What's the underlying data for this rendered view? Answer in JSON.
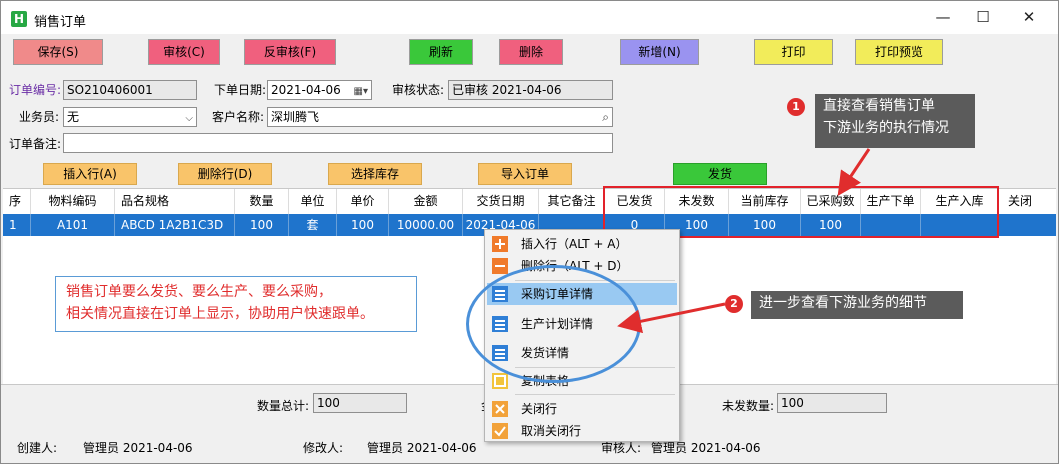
{
  "window": {
    "title": "销售订单",
    "icon_letter": "H",
    "minimize": "—",
    "maximize": "☐",
    "close": "✕"
  },
  "toolbar": {
    "save": "保存(S)",
    "review": "审核(C)",
    "unreview": "反审核(F)",
    "refresh": "刷新",
    "delete": "删除",
    "add": "新增(N)",
    "print": "打印",
    "print_preview": "打印预览"
  },
  "form": {
    "order_no_label": "订单编号:",
    "order_no": "SO210406001",
    "order_date_label": "下单日期:",
    "order_date": "2021-04-06",
    "audit_status_label": "审核状态:",
    "audit_status": "已审核 2021-04-06",
    "salesman_label": "业务员:",
    "salesman": "无",
    "customer_label": "客户名称:",
    "customer": "深圳腾飞",
    "remark_label": "订单备注:",
    "remark": ""
  },
  "subtoolbar": {
    "insert_row": "插入行(A)",
    "delete_row": "删除行(D)",
    "select_stock": "选择库存",
    "import_order": "导入订单",
    "ship": "发货"
  },
  "table": {
    "headers": [
      "序号",
      "物料编码",
      "品名规格",
      "数量",
      "单位",
      "单价",
      "金额",
      "交货日期",
      "其它备注",
      "已发货",
      "未发数",
      "当前库存",
      "已采购数",
      "生产下单",
      "生产入库",
      "关闭"
    ],
    "rows": [
      [
        "1",
        "A101",
        "ABCD 1A2B1C3D",
        "100",
        "套",
        "100",
        "10000.00",
        "2021-04-06",
        "",
        "0",
        "100",
        "100",
        "100",
        "",
        "",
        ""
      ]
    ]
  },
  "callouts": {
    "c1_num": "1",
    "c1_line1": "直接查看销售订单",
    "c1_line2": "下游业务的执行情况",
    "c2_num": "2",
    "c2_text": "进一步查看下游业务的细节",
    "note_line1": "销售订单要么发货、要么生产、要么采购，",
    "note_line2": "相关情况直接在订单上显示，协助用户快速跟单。"
  },
  "context_menu": {
    "insert_row": "插入行（ALT + A）",
    "delete_row": "删除行（ALT + D）",
    "purchase_detail": "采购订单详情",
    "production_detail": "生产计划详情",
    "shipping_detail": "发货详情",
    "copy_table": "复制表格",
    "close_row": "关闭行",
    "cancel_close_row": "取消关闭行"
  },
  "footer": {
    "qty_total_label": "数量总计:",
    "qty_total": "100",
    "amount_label_partial": "金",
    "unshipped_label": "未发数量:",
    "unshipped": "100",
    "creator_label": "创建人:",
    "creator": "管理员  2021-04-06",
    "modifier_label": "修改人:",
    "modifier": "管理员  2021-04-06",
    "auditor_label_partial": "审核人:",
    "auditor": "管理员  2021-04-06"
  },
  "colors": {
    "save": "#f08a8a",
    "review": "#f0607e",
    "unreview": "#f0607e",
    "refresh": "#3ac83a",
    "delete": "#f0607e",
    "add": "#9a93f0",
    "print": "#f2ec5a",
    "print_preview": "#f2ec5a",
    "row_selected": "#1f74cc",
    "callout_red": "#e02d2d"
  }
}
